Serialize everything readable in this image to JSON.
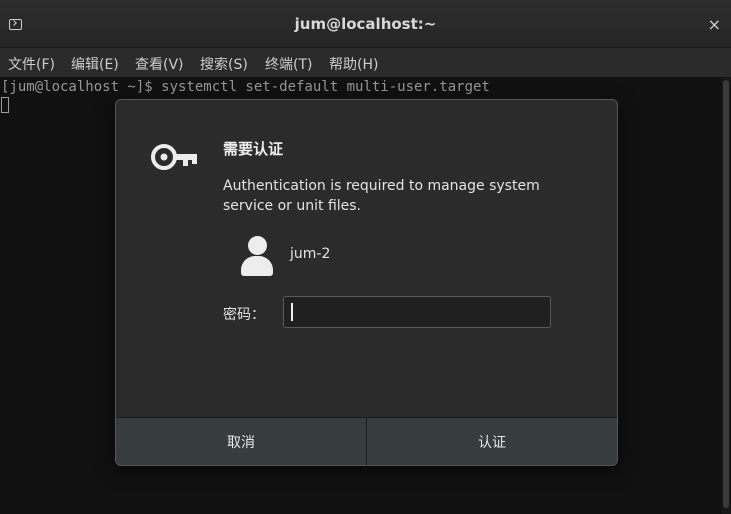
{
  "window": {
    "title": "jum@localhost:~",
    "close_glyph": "×",
    "app_icon": "terminal-icon"
  },
  "menubar": {
    "items": [
      "文件(F)",
      "编辑(E)",
      "查看(V)",
      "搜索(S)",
      "终端(T)",
      "帮助(H)"
    ]
  },
  "terminal": {
    "prompt_line": "[jum@localhost ~]$ systemctl set-default multi-user.target"
  },
  "dialog": {
    "icon": "key-icon",
    "heading": "需要认证",
    "message": "Authentication is required to manage system service or unit files.",
    "user_icon": "user-avatar-icon",
    "username": "jum-2",
    "password_label": "密码：",
    "password_value": "",
    "cancel_label": "取消",
    "auth_label": "认证"
  }
}
